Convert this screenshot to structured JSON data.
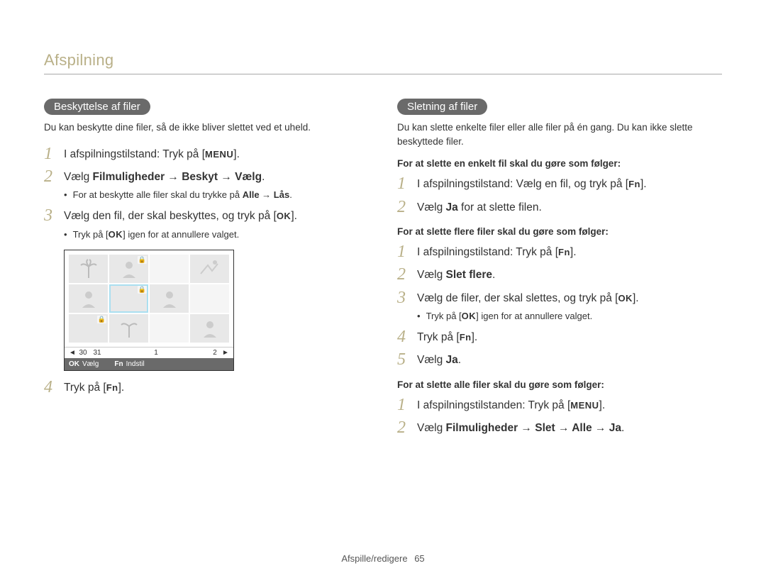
{
  "header": {
    "section": "Afspilning"
  },
  "left": {
    "pill": "Beskyttelse af filer",
    "intro": "Du kan beskytte dine filer, så de ikke bliver slettet ved et uheld.",
    "s1_a": "I afspilningstilstand: Tryk på [",
    "s1_key": "MENU",
    "s1_b": "].",
    "s2_a": "Vælg ",
    "s2_bold": "Filmuligheder → Beskyt → Vælg",
    "s2_b": ".",
    "b1_a": "For at beskytte alle filer skal du trykke på ",
    "b1_bold": "Alle → Lås",
    "b1_b": ".",
    "s3_a": "Vælg den fil, der skal beskyttes, og tryk på [",
    "s3_key": "OK",
    "s3_b": "].",
    "b2_a": "Tryk på [",
    "b2_key": "OK",
    "b2_b": "] igen for at annullere valget.",
    "s4_a": "Tryk på [",
    "s4_key": "Fn",
    "s4_b": "].",
    "shot": {
      "dates": {
        "d1": "30",
        "d2": "31",
        "d3": "1",
        "d4": "2"
      },
      "status": {
        "k1": "OK",
        "l1": "Vælg",
        "k2": "Fn",
        "l2": "Indstil"
      }
    }
  },
  "right": {
    "pill": "Sletning af filer",
    "intro": "Du kan slette enkelte filer eller alle filer på én gang. Du kan ikke slette beskyttede filer.",
    "sub1": "For at slette en enkelt fil skal du gøre som følger:",
    "a1_a": "I afspilningstilstand: Vælg en fil, og tryk på [",
    "a1_key": "Fn",
    "a1_b": "].",
    "a2_a": "Vælg ",
    "a2_bold": "Ja",
    "a2_b": " for at slette filen.",
    "sub2": "For at slette flere filer skal du gøre som følger:",
    "b1_a": "I afspilningstilstand: Tryk på [",
    "b1_key": "Fn",
    "b1_b": "].",
    "b2_a": "Vælg ",
    "b2_bold": "Slet flere",
    "b2_b": ".",
    "b3_a": "Vælg de filer, der skal slettes, og tryk på [",
    "b3_key": "OK",
    "b3_b": "].",
    "bb_a": "Tryk på [",
    "bb_key": "OK",
    "bb_b": "] igen for at annullere valget.",
    "b4_a": "Tryk på [",
    "b4_key": "Fn",
    "b4_b": "].",
    "b5_a": "Vælg ",
    "b5_bold": "Ja",
    "b5_b": ".",
    "sub3": "For at slette alle filer skal du gøre som følger:",
    "c1_a": "I afspilningstilstanden: Tryk på [",
    "c1_key": "MENU",
    "c1_b": "].",
    "c2_a": "Vælg ",
    "c2_bold": "Filmuligheder → Slet → Alle → Ja",
    "c2_b": "."
  },
  "footer": {
    "label": "Afspille/redigere",
    "page": "65"
  }
}
